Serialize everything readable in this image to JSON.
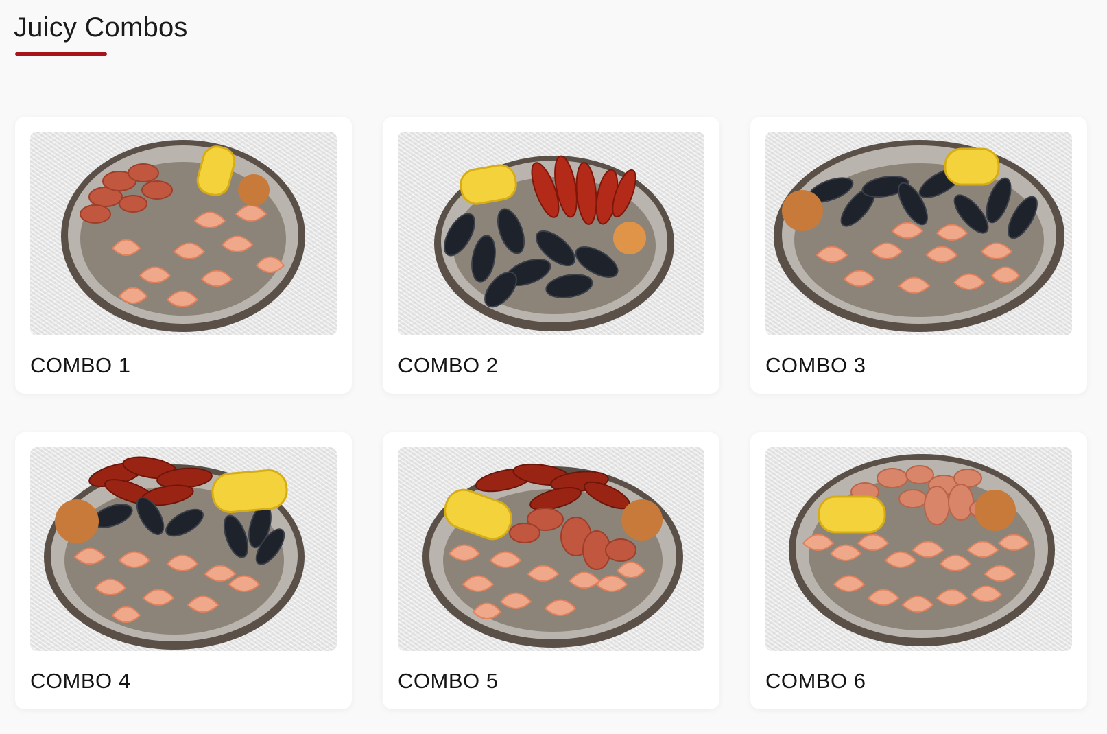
{
  "section": {
    "title": "Juicy Combos",
    "accent_color": "#a8141c"
  },
  "combos": [
    {
      "label": "COMBO 1",
      "items": [
        "sausage",
        "shrimp",
        "corn",
        "potato"
      ]
    },
    {
      "label": "COMBO 2",
      "items": [
        "crawfish",
        "mussels",
        "corn",
        "potato"
      ]
    },
    {
      "label": "COMBO 3",
      "items": [
        "shrimp",
        "mussels",
        "corn",
        "potato"
      ]
    },
    {
      "label": "COMBO 4",
      "items": [
        "crawfish",
        "mussels",
        "shrimp",
        "corn",
        "potato"
      ]
    },
    {
      "label": "COMBO 5",
      "items": [
        "crawfish",
        "sausage",
        "shrimp",
        "corn",
        "potato"
      ]
    },
    {
      "label": "COMBO 6",
      "items": [
        "sausage",
        "shrimp",
        "corn",
        "potato"
      ]
    }
  ]
}
